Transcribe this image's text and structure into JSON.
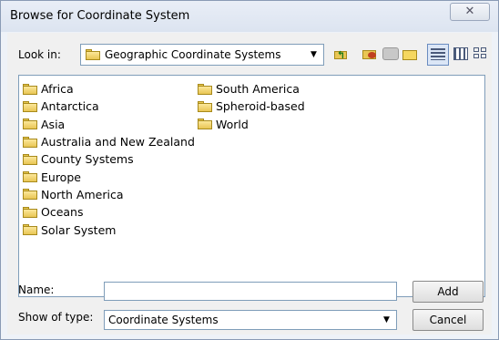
{
  "window": {
    "title": "Browse for Coordinate System",
    "close_glyph": "✕"
  },
  "toolbar": {
    "look_in_label": "Look in:",
    "look_in_value": "Geographic Coordinate Systems",
    "buttons": [
      {
        "name": "up-one-level",
        "icon": "folder-up-icon"
      },
      {
        "name": "connect-to-folder",
        "icon": "connect-folder-icon"
      },
      {
        "name": "disconnect-from-folder",
        "icon": "disconnect-icon"
      },
      {
        "name": "new-folder",
        "icon": "new-folder-icon"
      },
      {
        "name": "list-view",
        "icon": "list-view-icon",
        "active": true
      },
      {
        "name": "details-view",
        "icon": "details-view-icon"
      },
      {
        "name": "thumbnails-view",
        "icon": "thumbnails-view-icon"
      }
    ]
  },
  "folders": {
    "col1": [
      "Africa",
      "Antarctica",
      "Asia",
      "Australia and New Zealand",
      "County Systems",
      "Europe",
      "North America",
      "Oceans",
      "Solar System"
    ],
    "col2": [
      "South America",
      "Spheroid-based",
      "World"
    ]
  },
  "form": {
    "name_label": "Name:",
    "name_value": "",
    "type_label": "Show of type:",
    "type_value": "Coordinate Systems"
  },
  "actions": {
    "add_label": "Add",
    "cancel_label": "Cancel"
  },
  "colors": {
    "folder": "#e9c654",
    "border": "#7f9db9"
  }
}
